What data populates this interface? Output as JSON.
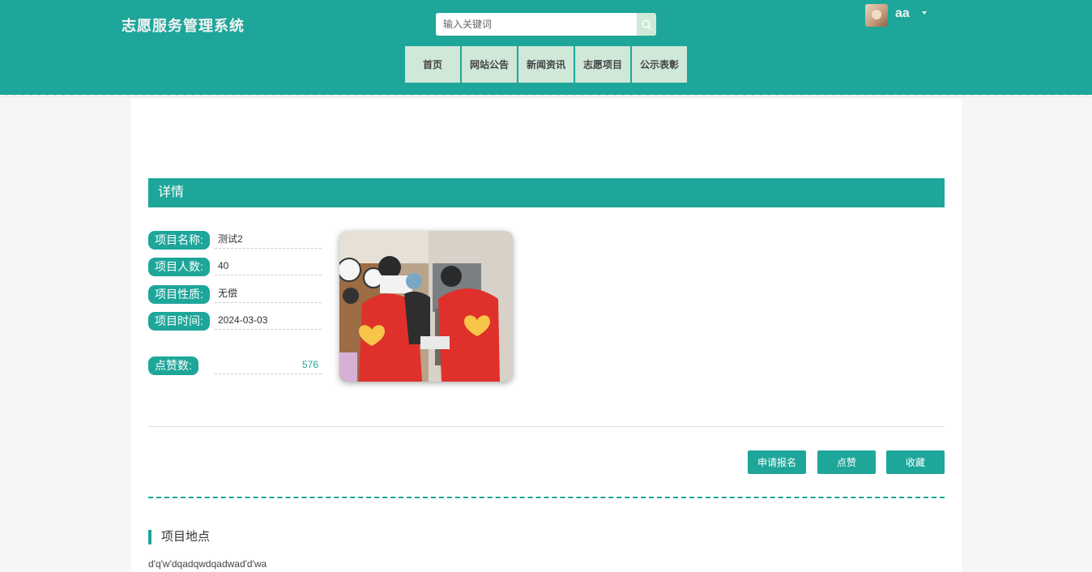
{
  "header": {
    "site_title": "志愿服务管理系统",
    "search_placeholder": "输入关键词",
    "username": "aa",
    "nav": [
      "首页",
      "网站公告",
      "新闻资讯",
      "志愿项目",
      "公示表彰"
    ]
  },
  "detail": {
    "section_title": "详情",
    "fields": [
      {
        "label": "项目名称:",
        "value": "测试2"
      },
      {
        "label": "项目人数:",
        "value": "40"
      },
      {
        "label": "项目性质:",
        "value": "无偿"
      },
      {
        "label": "项目时间:",
        "value": "2024-03-03"
      }
    ],
    "likes_label": "点赞数:",
    "likes_value": "576",
    "buttons": {
      "apply": "申请报名",
      "like": "点赞",
      "favorite": "收藏"
    }
  },
  "location": {
    "title": "项目地点",
    "text": "d'q'w'dqadqwdqadwad'd'wa"
  },
  "colors": {
    "accent": "#1ea69a",
    "nav_bg": "#cfe8d8"
  }
}
